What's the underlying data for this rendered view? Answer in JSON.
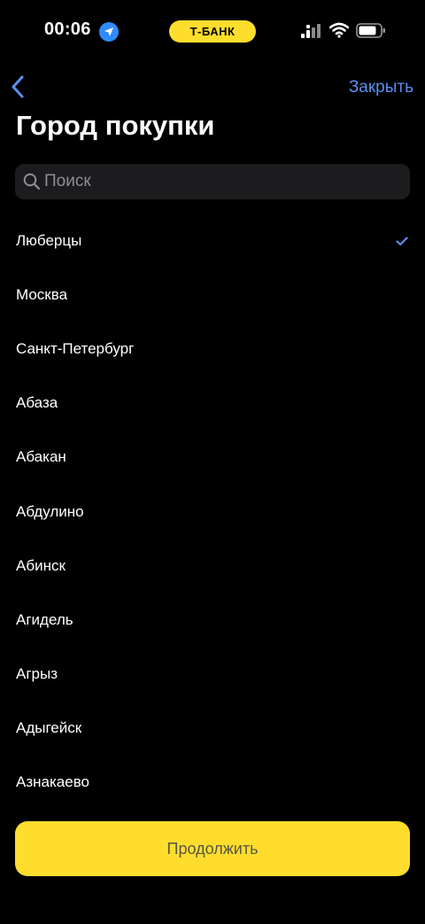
{
  "status_bar": {
    "time": "00:06",
    "bank_label": "Т-БАНК",
    "location_icon": "location-arrow-icon",
    "signal_icon": "signal-icon",
    "wifi_icon": "wifi-icon",
    "battery_icon": "battery-icon"
  },
  "nav": {
    "back_icon": "chevron-left-icon",
    "close_label": "Закрыть"
  },
  "page": {
    "title": "Город покупки"
  },
  "search": {
    "placeholder": "Поиск",
    "value": ""
  },
  "cities": [
    {
      "label": "Люберцы",
      "selected": true
    },
    {
      "label": "Москва",
      "selected": false
    },
    {
      "label": "Санкт-Петербург",
      "selected": false
    },
    {
      "label": "Абаза",
      "selected": false
    },
    {
      "label": "Абакан",
      "selected": false
    },
    {
      "label": "Абдулино",
      "selected": false
    },
    {
      "label": "Абинск",
      "selected": false
    },
    {
      "label": "Агидель",
      "selected": false
    },
    {
      "label": "Агрыз",
      "selected": false
    },
    {
      "label": "Адыгейск",
      "selected": false
    },
    {
      "label": "Азнакаево",
      "selected": false
    }
  ],
  "continue_label": "Продолжить",
  "colors": {
    "background": "#000000",
    "accent_yellow": "#ffdd2d",
    "link_blue": "#5b8fef",
    "search_bg": "#1c1c1e"
  }
}
